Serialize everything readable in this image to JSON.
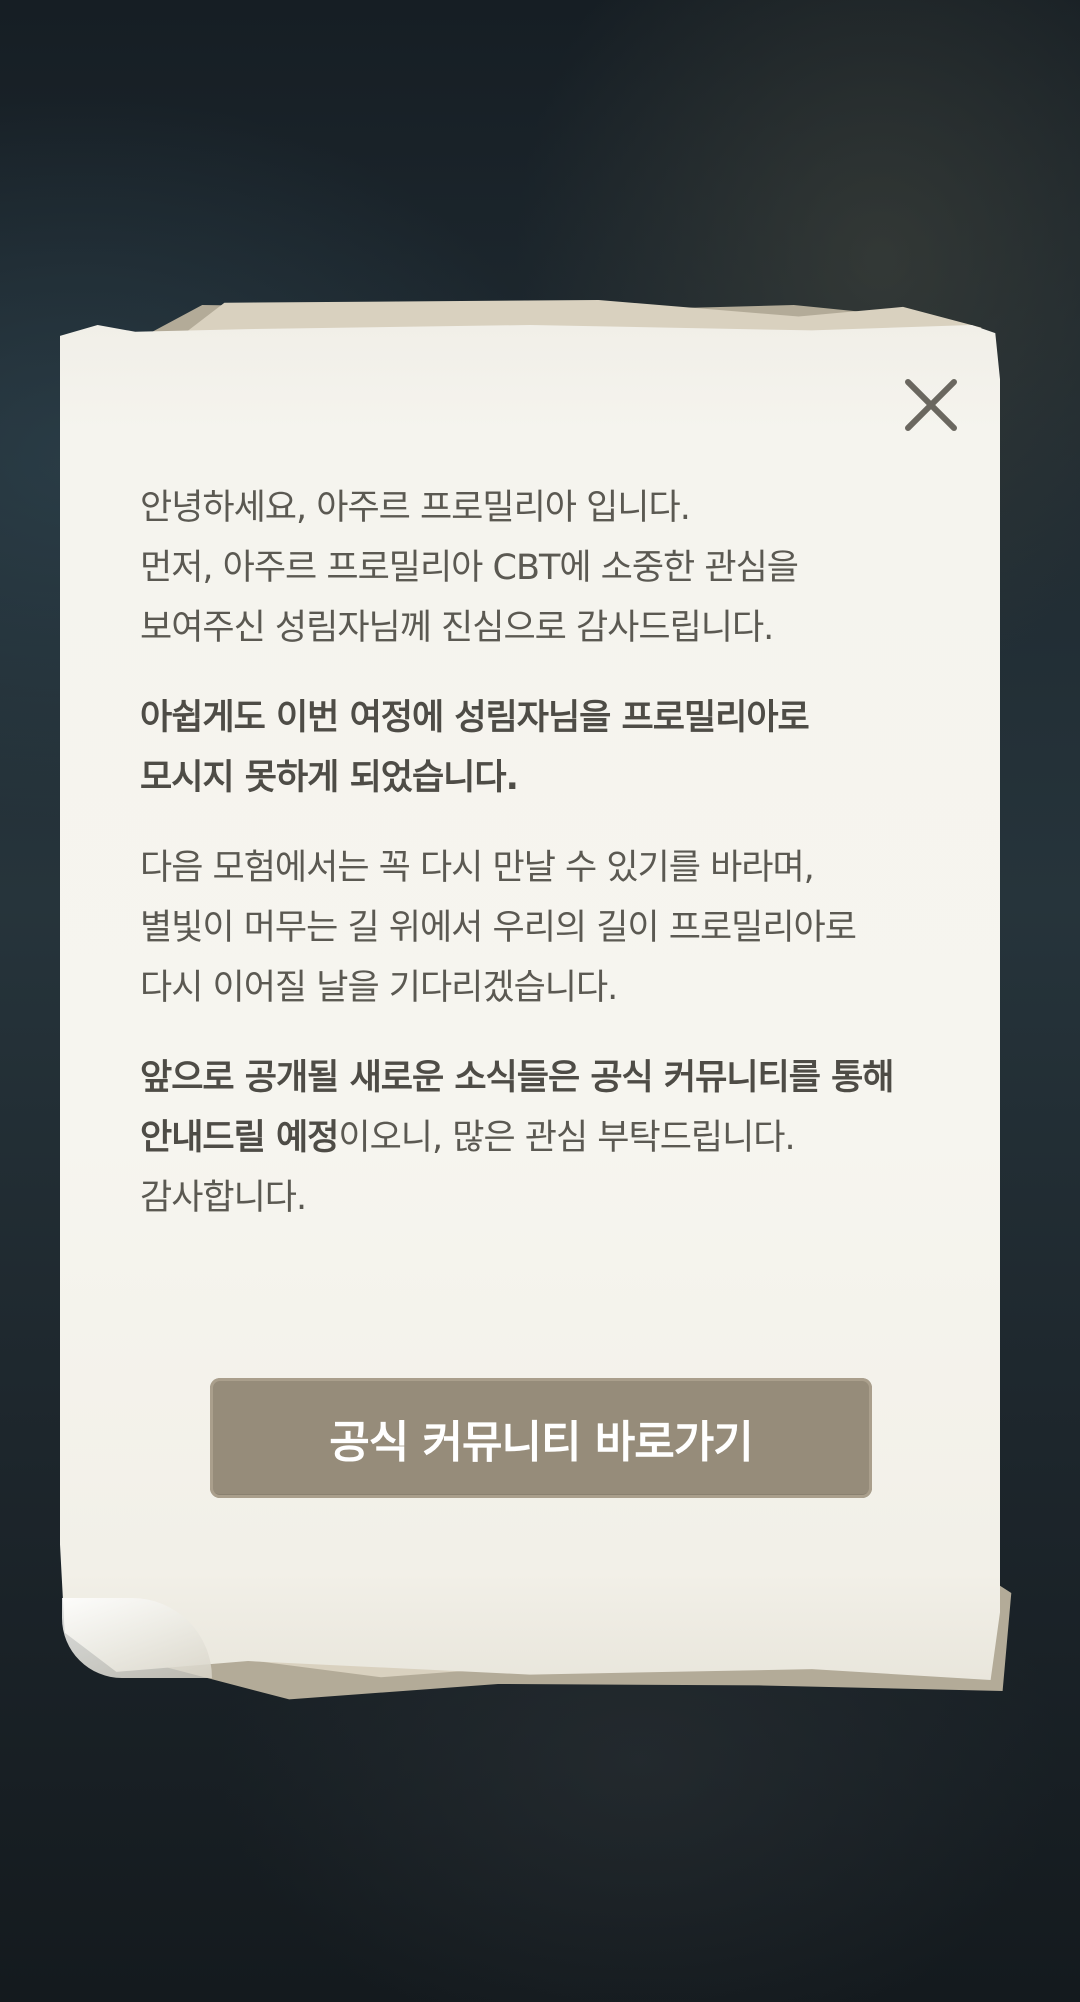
{
  "dialog": {
    "close_label": "Close",
    "paragraphs": [
      {
        "lines": [
          "안녕하세요, 아주르 프로밀리아 입니다.",
          "먼저, 아주르 프로밀리아 CBT에 소중한 관심을",
          "보여주신 성림자님께 진심으로 감사드립니다."
        ]
      },
      {
        "lines": [
          "아쉽게도 이번 여정에 성림자님을 프로밀리아로",
          "모시지 못하게 되었습니다."
        ]
      },
      {
        "lines": [
          "다음 모험에서는 꼭 다시 만날 수 있기를 바라며,",
          "별빛이 머무는 길 위에서 우리의 길이 프로밀리아로",
          "다시 이어질 날을 기다리겠습니다."
        ]
      },
      {
        "lines": [
          "앞으로 공개될 새로운 소식들은 공식 커뮤니티를 통해",
          "안내드릴 예정",
          "이오니, 많은 관심 부탁드립니다.",
          "감사합니다."
        ]
      }
    ],
    "community_button_label": "공식 커뮤니티 바로가기"
  },
  "icons": {
    "close": "close-icon"
  },
  "colors": {
    "paper": "#f6f5ef",
    "text": "#5b5952",
    "button": "#968c7a",
    "background": "#1f2a31"
  }
}
